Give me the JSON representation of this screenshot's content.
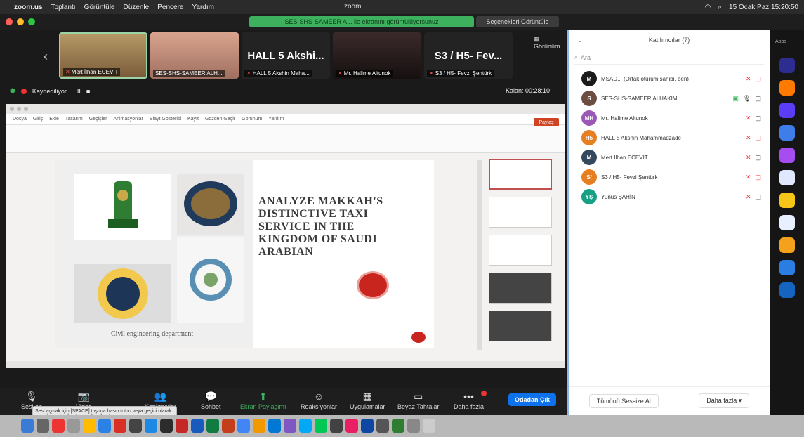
{
  "menubar": {
    "app": "zoom.us",
    "items": [
      "Toplantı",
      "Görüntüle",
      "Düzenle",
      "Pencere",
      "Yardım"
    ],
    "window_title": "zoom",
    "status": "15 Ocak Paz 15:20:50"
  },
  "titlebar": {
    "banner": "SES-SHS-SAMEER A... ile ekranını görüntülüyorsunuz",
    "options": "Seçenekleri Görüntüle"
  },
  "thumbnails": [
    {
      "caption": "Mert İlhan ECEVİT",
      "kind": "video1"
    },
    {
      "caption": "SES-SHS-SAMEER ALH...",
      "kind": "video2"
    },
    {
      "caption": "HALL 5 Akshin Maha...",
      "big": "HALL 5 Akshi...",
      "kind": "name"
    },
    {
      "caption": "Mr. Halime Altunok",
      "kind": "video3"
    },
    {
      "caption": "S3 / H5- Fevzi Şentürk",
      "big": "S3 / H5- Fev...",
      "kind": "name"
    }
  ],
  "view_toggle": "Görünüm",
  "recording": {
    "label": "Kaydediliyor...",
    "pause": "II",
    "stop": "■"
  },
  "timer": "Kalan: 00:28:10",
  "ppt": {
    "menu": [
      "Dosya",
      "Giriş",
      "Ekle",
      "Tasarım",
      "Geçişler",
      "Animasyonlar",
      "Slayt Gösterisi",
      "Kayıt",
      "Gözden Geçir",
      "Görünüm",
      "Yardım"
    ],
    "share": "Paylaş"
  },
  "slide": {
    "title": "ANALYZE MAKKAH'S DISTINCTIVE TAXI SERVICE IN THE KINGDOM OF SAUDI ARABIAN",
    "department": "Civil engineering department"
  },
  "toolbar": {
    "buttons": [
      {
        "label": "Sesi Aç",
        "icon": "🎙"
      },
      {
        "label": "Video",
        "icon": "📷"
      },
      {
        "label": "Katılımcılar",
        "icon": "👥"
      },
      {
        "label": "Sohbet",
        "icon": "💬"
      },
      {
        "label": "Ekran Paylaşımı",
        "icon": "⬆"
      },
      {
        "label": "Reaksiyonlar",
        "icon": "☺"
      },
      {
        "label": "Uygulamalar",
        "icon": "▦"
      },
      {
        "label": "Beyaz Tahtalar",
        "icon": "▭"
      },
      {
        "label": "Daha fazla",
        "icon": "•••"
      }
    ],
    "leave": "Odadan Çık",
    "tooltip": "Sesi açmak için [SPACE] tuşuna basılı tutun veya geçici olarak açmak için boşluk tuşunu basılı tutun"
  },
  "participants": {
    "title": "Katılımcılar (7)",
    "search_placeholder": "Ara",
    "list": [
      {
        "initials": "M",
        "name": "MSAD... (Ortak oturum sahibi, ben)",
        "color": "#1b1b1b"
      },
      {
        "initials": "S",
        "name": "SES-SHS-SAMEER ALHAKIMI",
        "color": "#6d4c41"
      },
      {
        "initials": "MH",
        "name": "Mr. Halime Altunok",
        "color": "#9b59b6"
      },
      {
        "initials": "H5",
        "name": "HALL 5 Akshin Mahammadzade",
        "color": "#e67e22"
      },
      {
        "initials": "M",
        "name": "Mert İlhan ECEVİT",
        "color": "#34495e"
      },
      {
        "initials": "S/",
        "name": "S3 / H5- Fevzi Şentürk",
        "color": "#e67e22"
      },
      {
        "initials": "YŞ",
        "name": "Yunus ŞAHİN",
        "color": "#16a085"
      }
    ],
    "invite": "Tümünü Sessize Al",
    "more": "Daha fazla ▾"
  },
  "strip": {
    "title": "Apps"
  },
  "colors": {
    "accent": "#0e72ed",
    "share": "#3db15e",
    "danger": "#e33333"
  }
}
